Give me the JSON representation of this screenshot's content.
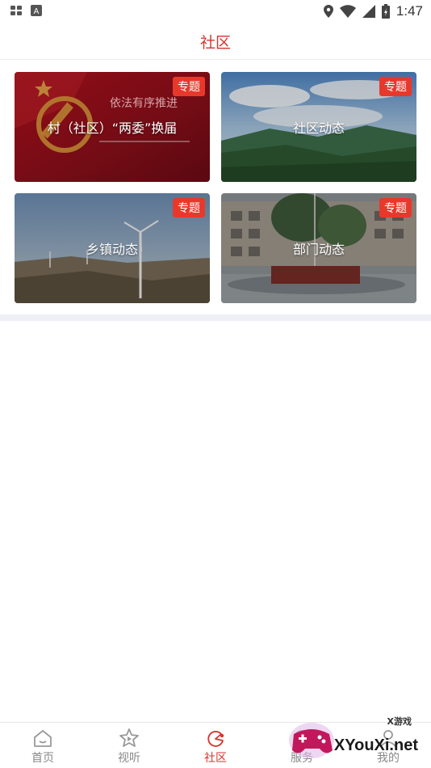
{
  "status_bar": {
    "time": "1:47"
  },
  "header": {
    "title": "社区"
  },
  "cards": [
    {
      "title": "村（社区）“两委”换届",
      "badge": "专题",
      "overlay_text": "依法有序推进"
    },
    {
      "title": "社区动态",
      "badge": "专题"
    },
    {
      "title": "乡镇动态",
      "badge": "专题"
    },
    {
      "title": "部门动态",
      "badge": "专题"
    }
  ],
  "tabbar": {
    "tabs": [
      {
        "label": "首页",
        "icon": "home-icon"
      },
      {
        "label": "视听",
        "icon": "star-play-icon"
      },
      {
        "label": "社区",
        "icon": "community-icon",
        "active": true
      },
      {
        "label": "服务",
        "icon": "service-icon"
      },
      {
        "label": "我的",
        "icon": "profile-icon"
      }
    ]
  },
  "watermark": {
    "brand": "XYouXi.net",
    "small": "X游戏"
  },
  "colors": {
    "accent": "#d7332c",
    "badge": "#e8382c",
    "tab_inactive": "#888888"
  }
}
